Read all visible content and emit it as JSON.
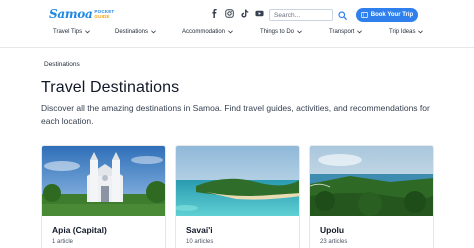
{
  "header": {
    "logo": {
      "name": "Samoa",
      "tag_line1": "POCKET",
      "tag_line2": "GUIDE"
    },
    "socials": [
      {
        "icon": "facebook-icon"
      },
      {
        "icon": "instagram-icon"
      },
      {
        "icon": "tiktok-icon"
      },
      {
        "icon": "youtube-icon"
      }
    ],
    "search": {
      "placeholder": "Search..."
    },
    "book_label": "Book Your Trip",
    "accent_color": "#2f80ed"
  },
  "nav": {
    "items": [
      {
        "label": "Travel Tips"
      },
      {
        "label": "Destinations"
      },
      {
        "label": "Accommodation"
      },
      {
        "label": "Things to Do"
      },
      {
        "label": "Transport"
      },
      {
        "label": "Trip Ideas"
      }
    ]
  },
  "breadcrumb": "Destinations",
  "page": {
    "title": "Travel Destinations",
    "description": "Discover all the amazing destinations in Samoa. Find travel guides, activities, and recommendations for each location."
  },
  "cards": [
    {
      "name": "Apia (Capital)",
      "count": "1 article",
      "image": "church-cathedral-image"
    },
    {
      "name": "Savai'i",
      "count": "10 articles",
      "image": "island-coast-image"
    },
    {
      "name": "Upolu",
      "count": "23 articles",
      "image": "forest-coastline-image"
    }
  ]
}
